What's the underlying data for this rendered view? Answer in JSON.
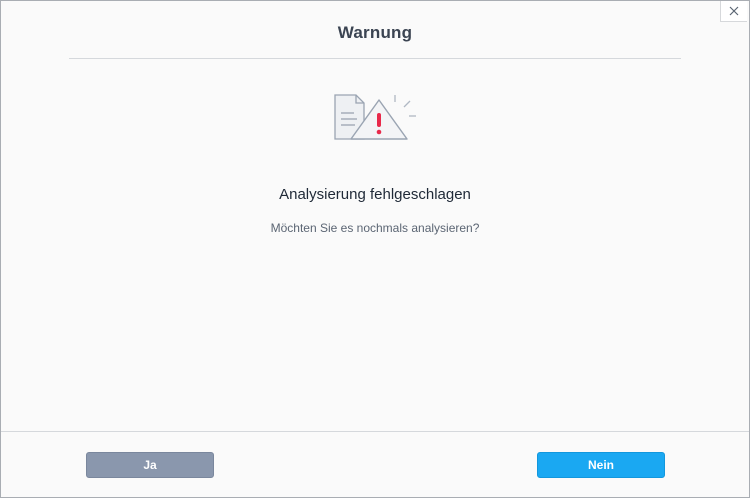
{
  "dialog": {
    "title": "Warnung",
    "heading": "Analysierung fehlgeschlagen",
    "question": "Möchten Sie es nochmals analysieren?",
    "icons": {
      "close": "close-icon",
      "illustration": "warning-document-icon"
    },
    "buttons": {
      "yes_label": "Ja",
      "no_label": "Nein"
    },
    "colors": {
      "accent": "#1aa8f2",
      "secondary_button": "#8a97ad",
      "warning_mark": "#e8294a"
    }
  }
}
